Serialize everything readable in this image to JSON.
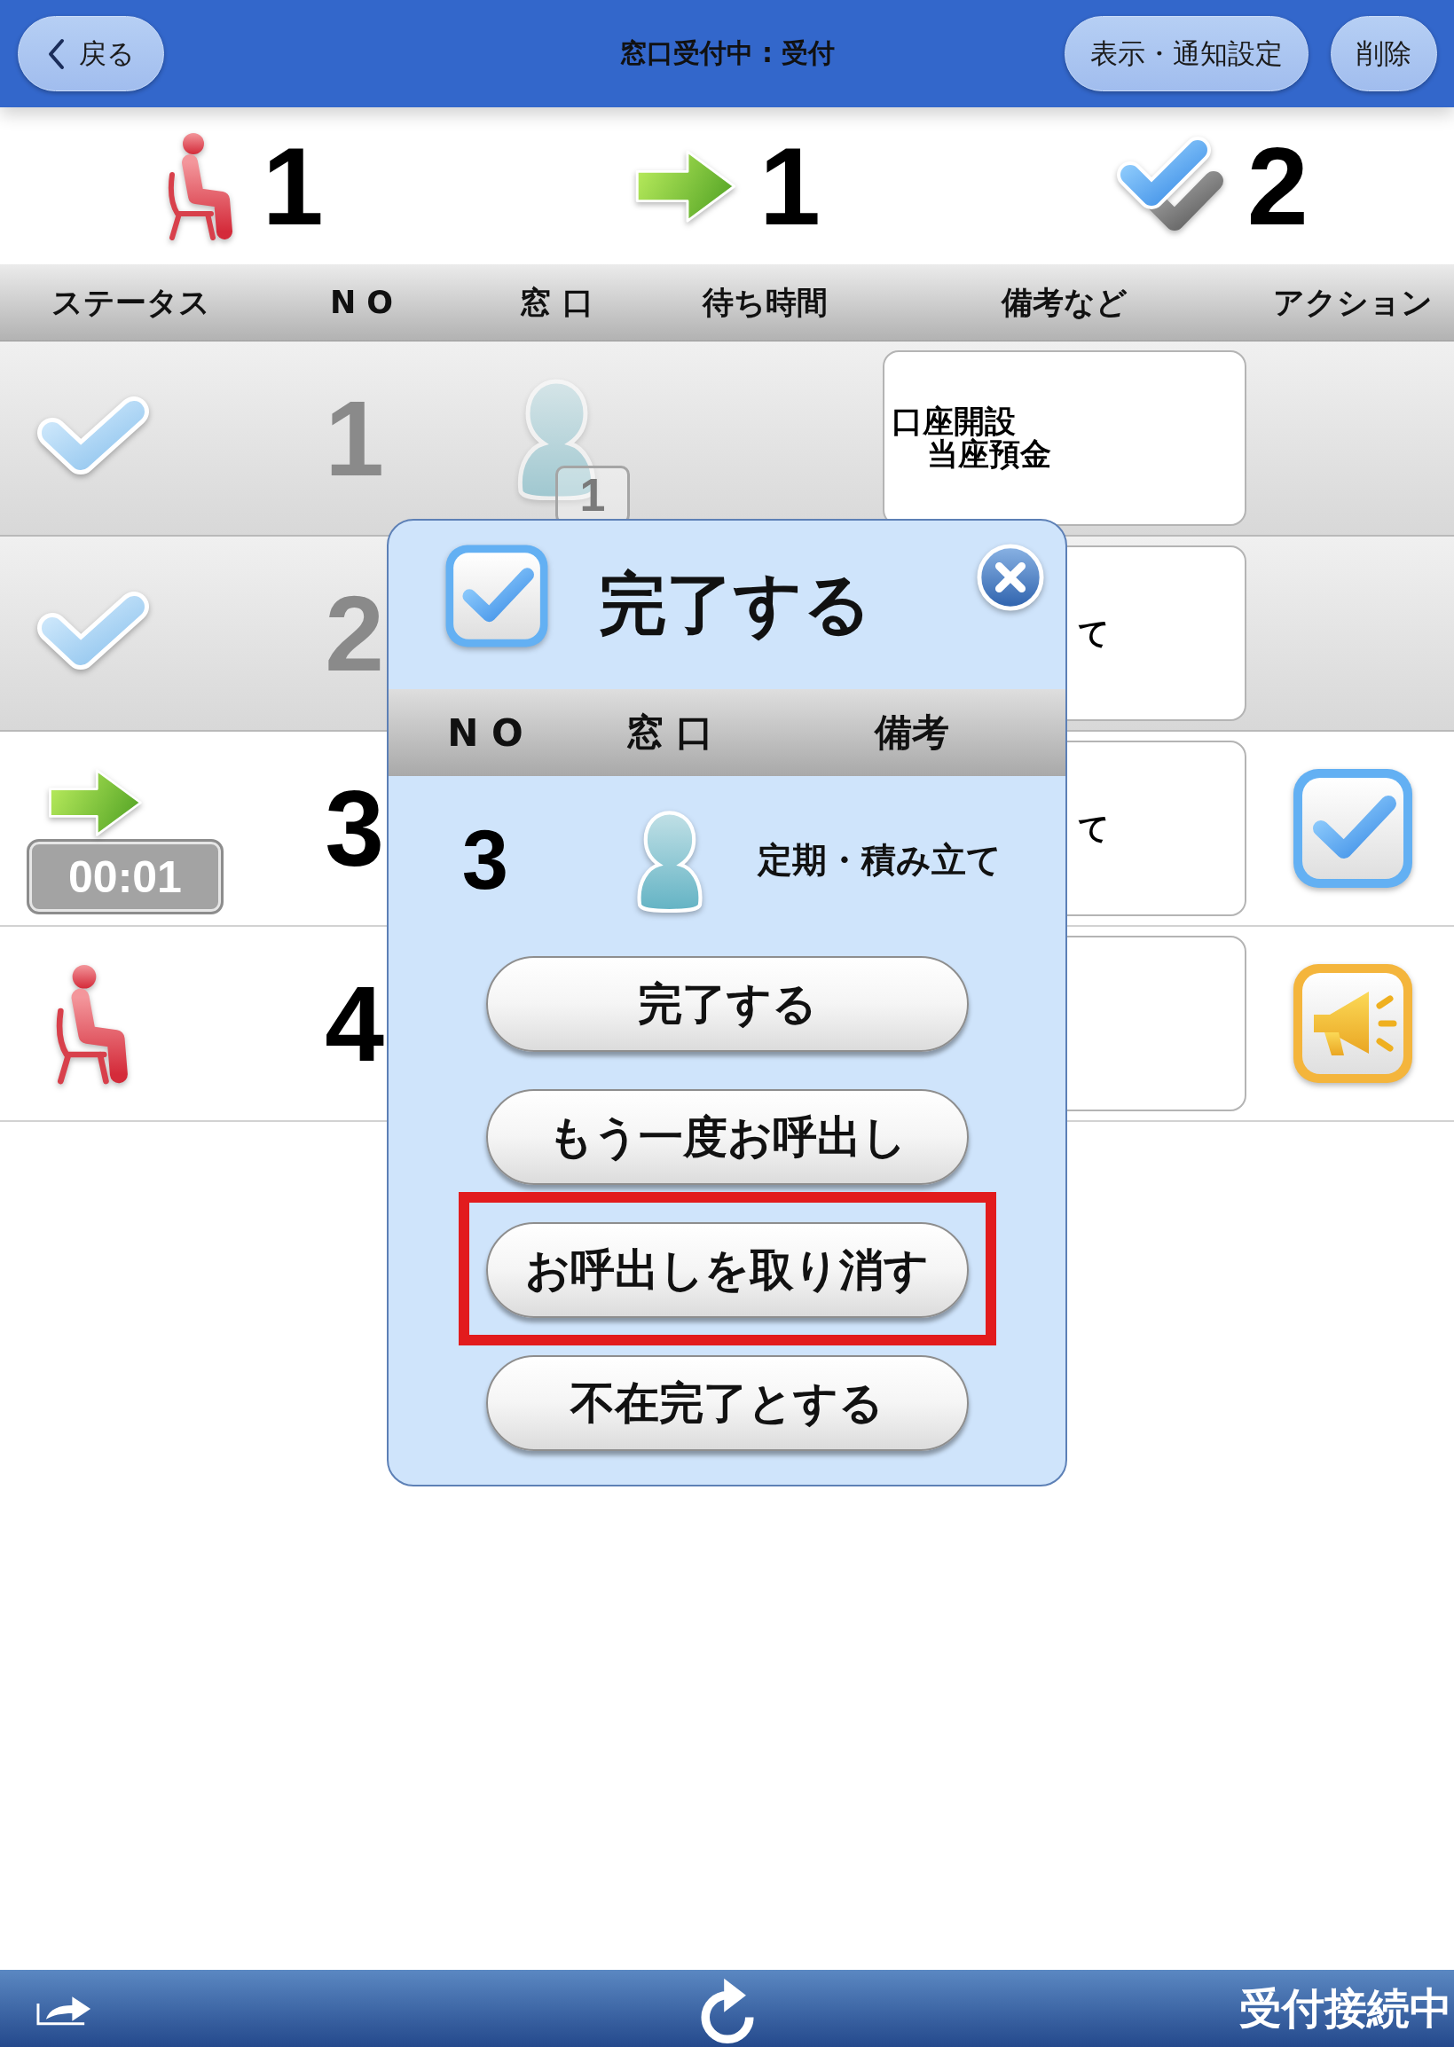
{
  "top_bar": {
    "back_button": "戻る",
    "title": "窓口受付中 : 受付",
    "buttons": [
      "表示・通知設定",
      "削除"
    ]
  },
  "summary": [
    {
      "kind": "waiting",
      "count": "1"
    },
    {
      "kind": "called",
      "count": "1"
    },
    {
      "kind": "done",
      "count": "2"
    }
  ],
  "table": {
    "columns": [
      "ステータス",
      "N O",
      "窓 口",
      "待ち時間",
      "備考など",
      "アクション"
    ],
    "rows": [
      {
        "kind": "done",
        "no": "1",
        "window_badge": "1",
        "remarks": [
          "口座開設",
          "当座預金"
        ]
      },
      {
        "kind": "done",
        "no": "2",
        "remarks_tail": "て"
      },
      {
        "kind": "called",
        "elapsed": "00:01",
        "no": "3",
        "remarks_tail": "て",
        "action": {
          "kind": "complete"
        }
      },
      {
        "kind": "waiting",
        "no": "4",
        "action": {
          "kind": "call"
        }
      }
    ]
  },
  "dialog": {
    "title": "完了する",
    "columns": [
      "N O",
      "窓 口",
      "備考"
    ],
    "row": {
      "no": "3",
      "remarks": "定期・積み立て"
    },
    "buttons": [
      {
        "label": "完了する",
        "highlighted": false
      },
      {
        "label": "もう一度お呼出し",
        "highlighted": false
      },
      {
        "label": "お呼出しを取り消す",
        "highlighted": true
      },
      {
        "label": "不在完了とする",
        "highlighted": false
      }
    ]
  },
  "bottom_bar": {
    "status": "受付接続中"
  }
}
